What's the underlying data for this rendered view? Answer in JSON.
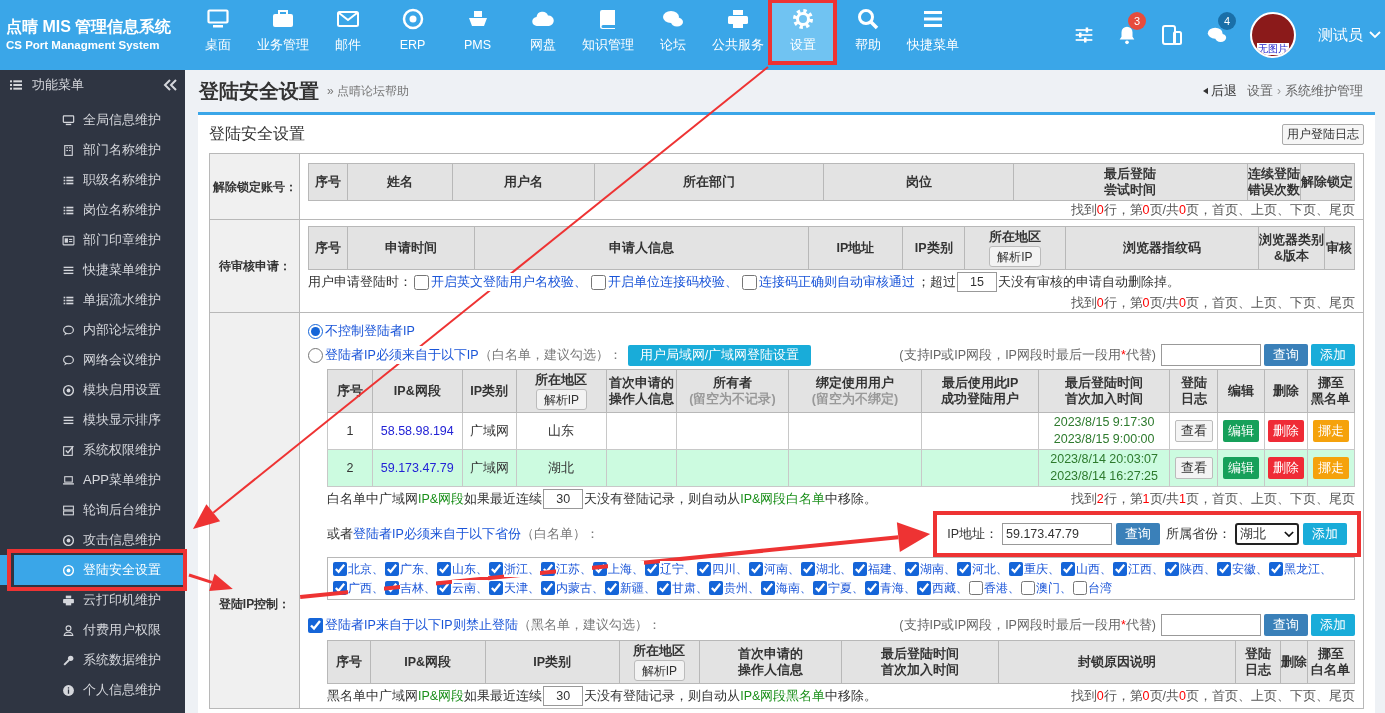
{
  "brand": {
    "title": "点晴 MIS 管理信息系统",
    "subtitle": "CS Port Managment System"
  },
  "nav": [
    {
      "label": "桌面",
      "selected": false
    },
    {
      "label": "业务管理",
      "selected": false
    },
    {
      "label": "邮件",
      "selected": false
    },
    {
      "label": "ERP",
      "selected": false
    },
    {
      "label": "PMS",
      "selected": false
    },
    {
      "label": "网盘",
      "selected": false
    },
    {
      "label": "知识管理",
      "selected": false
    },
    {
      "label": "论坛",
      "selected": false
    },
    {
      "label": "公共服务",
      "selected": false
    },
    {
      "label": "设置",
      "selected": true
    },
    {
      "label": "帮助",
      "selected": false
    },
    {
      "label": "快捷菜单",
      "selected": false
    }
  ],
  "toolbar": {
    "alerts": "3",
    "messages": "4",
    "avatar_label": "无图片",
    "user": "测试员"
  },
  "sidebar": {
    "title": "功能菜单",
    "items": [
      {
        "label": "全局信息维护",
        "selected": false
      },
      {
        "label": "部门名称维护",
        "selected": false
      },
      {
        "label": "职级名称维护",
        "selected": false
      },
      {
        "label": "岗位名称维护",
        "selected": false
      },
      {
        "label": "部门印章维护",
        "selected": false
      },
      {
        "label": "快捷菜单维护",
        "selected": false
      },
      {
        "label": "单据流水维护",
        "selected": false
      },
      {
        "label": "内部论坛维护",
        "selected": false
      },
      {
        "label": "网络会议维护",
        "selected": false
      },
      {
        "label": "模块启用设置",
        "selected": false
      },
      {
        "label": "模块显示排序",
        "selected": false
      },
      {
        "label": "系统权限维护",
        "selected": false
      },
      {
        "label": "APP菜单维护",
        "selected": false
      },
      {
        "label": "轮询后台维护",
        "selected": false
      },
      {
        "label": "攻击信息维护",
        "selected": false
      },
      {
        "label": "登陆安全设置",
        "selected": true
      },
      {
        "label": "云打印机维护",
        "selected": false
      },
      {
        "label": "付费用户权限",
        "selected": false
      },
      {
        "label": "系统数据维护",
        "selected": false
      },
      {
        "label": "个人信息维护",
        "selected": false
      }
    ]
  },
  "page": {
    "title": "登陆安全设置",
    "help": "» 点晴论坛帮助",
    "back": "后退",
    "breadcrumb": [
      "设置",
      "系统维护管理"
    ],
    "separator": "›"
  },
  "panel": {
    "title": "登陆安全设置",
    "log_button": "用户登陆日志"
  },
  "unlock": {
    "label": "解除锁定账号：",
    "columns": [
      {
        "lines": [
          "序号"
        ]
      },
      {
        "lines": [
          "姓名"
        ]
      },
      {
        "lines": [
          "用户名"
        ]
      },
      {
        "lines": [
          "所在部门"
        ]
      },
      {
        "lines": [
          "岗位"
        ]
      },
      {
        "lines": [
          "最后登陆",
          "尝试时间"
        ]
      },
      {
        "lines": [
          "连续登陆",
          "错误次数"
        ]
      },
      {
        "lines": [
          "解除锁定"
        ]
      }
    ],
    "pager": [
      {
        "text": "找到",
        "kind": "plain"
      },
      {
        "text": "0",
        "kind": "count"
      },
      {
        "text": "行，第",
        "kind": "plain"
      },
      {
        "text": "0",
        "kind": "count"
      },
      {
        "text": "页/共",
        "kind": "plain"
      },
      {
        "text": "0",
        "kind": "count"
      },
      {
        "text": "页，首页、上页、下页、尾页",
        "kind": "plain"
      }
    ]
  },
  "pending": {
    "label": "待审核申请：",
    "columns": [
      {
        "lines": [
          "序号"
        ]
      },
      {
        "lines": [
          "申请时间"
        ]
      },
      {
        "lines": [
          "申请人信息"
        ]
      },
      {
        "lines": [
          "IP地址"
        ]
      },
      {
        "lines": [
          "IP类别"
        ]
      },
      {
        "lines": [
          "所在地区"
        ],
        "button": "解析IP"
      },
      {
        "lines": [
          "浏览器指纹码"
        ]
      },
      {
        "lines": [
          "浏览器类别",
          "&版本"
        ]
      },
      {
        "lines": [
          "审核"
        ]
      }
    ],
    "options_prefix": "用户申请登陆时：",
    "options": [
      {
        "label": "开启英文登陆用户名校验、",
        "checked": false
      },
      {
        "label": "开启单位连接码校验、",
        "checked": false
      },
      {
        "label": "连接码正确则自动审核通过",
        "checked": false
      }
    ],
    "expire_before": "；超过",
    "expire_days": "15",
    "expire_after": "天没有审核的申请自动删除掉。",
    "pager": [
      {
        "text": "找到",
        "kind": "plain"
      },
      {
        "text": "0",
        "kind": "count"
      },
      {
        "text": "行，第",
        "kind": "plain"
      },
      {
        "text": "0",
        "kind": "count"
      },
      {
        "text": "页/共",
        "kind": "plain"
      },
      {
        "text": "0",
        "kind": "count"
      },
      {
        "text": "页，首页、上页、下页、尾页",
        "kind": "plain"
      }
    ]
  },
  "ip_control": {
    "label": "登陆IP控制：",
    "modes": [
      {
        "label": "不控制登陆者IP",
        "selected": true
      },
      {
        "label": "登陆者IP必须来自于以下IP",
        "note": "（白名单，建议勾选）：",
        "button": "用户局域网/广域网登陆设置",
        "selected": false
      }
    ],
    "whitelist_hint": [
      {
        "text": "(支持IP或IP网段，IP网段时最后一段用",
        "kind": "plain"
      },
      {
        "text": "*",
        "kind": "count"
      },
      {
        "text": "代替)",
        "kind": "plain"
      }
    ],
    "search_button": "查询",
    "add_button": "添加",
    "whitelist": {
      "columns": [
        {
          "lines": [
            "序号"
          ]
        },
        {
          "lines": [
            "IP&网段"
          ]
        },
        {
          "lines": [
            "IP类别"
          ]
        },
        {
          "lines": [
            "所在地区"
          ],
          "button": "解析IP"
        },
        {
          "lines": [
            "首次申请的",
            "操作人信息"
          ]
        },
        {
          "lines": [
            "所有者"
          ],
          "note": "(留空为不记录)"
        },
        {
          "lines": [
            "绑定使用用户"
          ],
          "note": "(留空为不绑定)"
        },
        {
          "lines": [
            "最后使用此IP",
            "成功登陆用户"
          ]
        },
        {
          "lines": [
            "最后登陆时间",
            "首次加入时间"
          ]
        },
        {
          "lines": [
            "登陆",
            "日志"
          ]
        },
        {
          "lines": [
            "编辑"
          ]
        },
        {
          "lines": [
            "删除"
          ]
        },
        {
          "lines": [
            "挪至",
            "黑名单"
          ]
        }
      ],
      "rows": [
        {
          "index": "1",
          "ip": "58.58.98.194",
          "type": "广域网",
          "region": "山东",
          "times": [
            "2023/8/15 9:17:30",
            "2023/8/15 9:00:00"
          ],
          "highlighted": false,
          "actions": [
            {
              "label": "查看",
              "kind": "view"
            },
            {
              "label": "编辑",
              "kind": "edit"
            },
            {
              "label": "删除",
              "kind": "delete"
            },
            {
              "label": "挪走",
              "kind": "move"
            }
          ]
        },
        {
          "index": "2",
          "ip": "59.173.47.79",
          "type": "广域网",
          "region": "湖北",
          "times": [
            "2023/8/14 20:03:07",
            "2023/8/14 16:27:25"
          ],
          "highlighted": true,
          "actions": [
            {
              "label": "查看",
              "kind": "view"
            },
            {
              "label": "编辑",
              "kind": "edit"
            },
            {
              "label": "删除",
              "kind": "delete"
            },
            {
              "label": "挪走",
              "kind": "move"
            }
          ]
        }
      ],
      "retention_before": [
        {
          "text": "白名单中广域网",
          "kind": "plain"
        },
        {
          "text": "IP&网段",
          "kind": "green"
        },
        {
          "text": "如果最近连续",
          "kind": "plain"
        }
      ],
      "retention_days": "30",
      "retention_after": [
        {
          "text": "天没有登陆记录，则自动从",
          "kind": "plain"
        },
        {
          "text": "IP&网段白名单",
          "kind": "green"
        },
        {
          "text": "中移除。",
          "kind": "plain"
        }
      ],
      "pager": [
        {
          "text": "找到",
          "kind": "plain"
        },
        {
          "text": "2",
          "kind": "count"
        },
        {
          "text": "行，第",
          "kind": "plain"
        },
        {
          "text": "1",
          "kind": "count"
        },
        {
          "text": "页/共",
          "kind": "plain"
        },
        {
          "text": "1",
          "kind": "count"
        },
        {
          "text": "页，首页、上页、下页、尾页",
          "kind": "plain"
        }
      ]
    },
    "province_rule": {
      "prefix": "或者",
      "link": "登陆者IP必须来自于以下省份",
      "note": "（白名单）：",
      "ip_label": "IP地址：",
      "ip_value": "59.173.47.79",
      "search_button": "查询",
      "province_label": "所属省份：",
      "province_value": "湖北",
      "add_button": "添加"
    },
    "provinces": [
      {
        "label": "北京、",
        "checked": true
      },
      {
        "label": "广东、",
        "checked": true
      },
      {
        "label": "山东、",
        "checked": true
      },
      {
        "label": "浙江、",
        "checked": true
      },
      {
        "label": "江苏、",
        "checked": true
      },
      {
        "label": "上海、",
        "checked": true
      },
      {
        "label": "辽宁、",
        "checked": true
      },
      {
        "label": "四川、",
        "checked": true
      },
      {
        "label": "河南、",
        "checked": true
      },
      {
        "label": "湖北、",
        "checked": true
      },
      {
        "label": "福建、",
        "checked": true
      },
      {
        "label": "湖南、",
        "checked": true
      },
      {
        "label": "河北、",
        "checked": true
      },
      {
        "label": "重庆、",
        "checked": true
      },
      {
        "label": "山西、",
        "checked": true
      },
      {
        "label": "江西、",
        "checked": true
      },
      {
        "label": "陕西、",
        "checked": true
      },
      {
        "label": "安徽、",
        "checked": true
      },
      {
        "label": "黑龙江、",
        "checked": true
      },
      {
        "label": "广西、",
        "checked": true
      },
      {
        "label": "吉林、",
        "checked": true
      },
      {
        "label": "云南、",
        "checked": true
      },
      {
        "label": "天津、",
        "checked": true
      },
      {
        "label": "内蒙古、",
        "checked": true
      },
      {
        "label": "新疆、",
        "checked": true
      },
      {
        "label": "甘肃、",
        "checked": true
      },
      {
        "label": "贵州、",
        "checked": true
      },
      {
        "label": "海南、",
        "checked": true
      },
      {
        "label": "宁夏、",
        "checked": true
      },
      {
        "label": "青海、",
        "checked": true
      },
      {
        "label": "西藏、",
        "checked": true
      },
      {
        "label": "香港、",
        "checked": false
      },
      {
        "label": "澳门、",
        "checked": false
      },
      {
        "label": "台湾",
        "checked": false
      }
    ],
    "blacklist": {
      "enabled": true,
      "label": "登陆者IP来自于以下IP则禁止登陆",
      "note": "（黑名单，建议勾选）：",
      "hint": [
        {
          "text": "(支持IP或IP网段，IP网段时最后一段用",
          "kind": "plain"
        },
        {
          "text": "*",
          "kind": "count"
        },
        {
          "text": "代替)",
          "kind": "plain"
        }
      ],
      "search_button": "查询",
      "add_button": "添加",
      "columns": [
        {
          "lines": [
            "序号"
          ]
        },
        {
          "lines": [
            "IP&网段"
          ]
        },
        {
          "lines": [
            "IP类别"
          ]
        },
        {
          "lines": [
            "所在地区"
          ],
          "button": "解析IP"
        },
        {
          "lines": [
            "首次申请的",
            "操作人信息"
          ]
        },
        {
          "lines": [
            "最后登陆时间",
            "首次加入时间"
          ]
        },
        {
          "lines": [
            "封锁原因说明"
          ]
        },
        {
          "lines": [
            "登陆",
            "日志"
          ]
        },
        {
          "lines": [
            "删除"
          ]
        },
        {
          "lines": [
            "挪至",
            "白名单"
          ]
        }
      ],
      "retention_before": [
        {
          "text": "黑名单中广域网",
          "kind": "plain"
        },
        {
          "text": "IP&网段",
          "kind": "green"
        },
        {
          "text": "如果最近连续",
          "kind": "plain"
        }
      ],
      "retention_days": "30",
      "retention_after": [
        {
          "text": "天没有登陆记录，则自动从",
          "kind": "plain"
        },
        {
          "text": "IP&网段黑名单",
          "kind": "green"
        },
        {
          "text": "中移除。",
          "kind": "plain"
        }
      ],
      "pager": [
        {
          "text": "找到",
          "kind": "plain"
        },
        {
          "text": "0",
          "kind": "count"
        },
        {
          "text": "行，第",
          "kind": "plain"
        },
        {
          "text": "0",
          "kind": "count"
        },
        {
          "text": "页/共",
          "kind": "plain"
        },
        {
          "text": "0",
          "kind": "count"
        },
        {
          "text": "页，首页、上页、下页、尾页",
          "kind": "plain"
        }
      ]
    }
  }
}
